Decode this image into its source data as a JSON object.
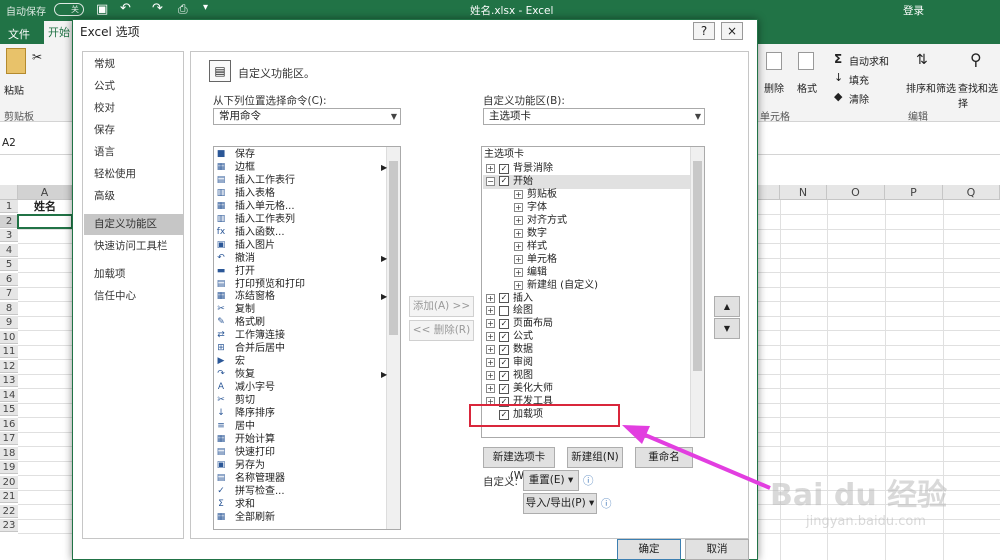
{
  "excel": {
    "autosave": "自动保存",
    "autosave_state": "关",
    "title": "姓名.xlsx  -  Excel",
    "login": "登录",
    "tab_file": "文件",
    "tab_home": "开始",
    "paste": "粘贴",
    "clipboard": "剪贴板",
    "delete": "删除",
    "format": "格式",
    "cells_group": "单元格",
    "autosum": "自动求和",
    "fill": "填充",
    "clear": "清除",
    "sort_filter": "排序和筛选",
    "find_select": "查找和选择",
    "editing_group": "编辑",
    "namebox": "A2",
    "col_a": "A",
    "cols_right": [
      "N",
      "O",
      "P",
      "Q"
    ],
    "a1_value": "姓名",
    "rows": [
      "1",
      "2",
      "3",
      "4",
      "5",
      "6",
      "7",
      "8",
      "9",
      "10",
      "11",
      "12",
      "13",
      "14",
      "15",
      "16",
      "17",
      "18",
      "19",
      "20",
      "21",
      "22",
      "23"
    ]
  },
  "dialog": {
    "title": "Excel 选项",
    "help_btn": "?",
    "close_btn": "×",
    "nav": [
      "常规",
      "公式",
      "校对",
      "保存",
      "语言",
      "轻松使用",
      "高级",
      "自定义功能区",
      "快速访问工具栏",
      "加载项",
      "信任中心"
    ],
    "nav_selected": "自定义功能区",
    "heading": "自定义功能区。",
    "choose_label": "从下列位置选择命令(C):",
    "choose_value": "常用命令",
    "customize_label": "自定义功能区(B):",
    "customize_value": "主选项卡",
    "commands": [
      {
        "icon": "■",
        "text": "保存"
      },
      {
        "icon": "▦",
        "text": "边框",
        "sub": true
      },
      {
        "icon": "▤",
        "text": "插入工作表行"
      },
      {
        "icon": "▥",
        "text": "插入表格"
      },
      {
        "icon": "▦",
        "text": "插入单元格..."
      },
      {
        "icon": "▥",
        "text": "插入工作表列"
      },
      {
        "icon": "fx",
        "text": "插入函数..."
      },
      {
        "icon": "▣",
        "text": "插入图片"
      },
      {
        "icon": "↶",
        "text": "撤消",
        "sub": true
      },
      {
        "icon": "▬",
        "text": "打开"
      },
      {
        "icon": "▤",
        "text": "打印预览和打印"
      },
      {
        "icon": "▦",
        "text": "冻结窗格",
        "sub": true
      },
      {
        "icon": "✂",
        "text": "复制"
      },
      {
        "icon": "✎",
        "text": "格式刷"
      },
      {
        "icon": "⇄",
        "text": "工作簿连接"
      },
      {
        "icon": "⊞",
        "text": "合并后居中"
      },
      {
        "icon": "▶",
        "text": "宏"
      },
      {
        "icon": "↷",
        "text": "恢复",
        "sub": true
      },
      {
        "icon": "A",
        "text": "减小字号"
      },
      {
        "icon": "✂",
        "text": "剪切"
      },
      {
        "icon": "↓",
        "text": "降序排序"
      },
      {
        "icon": "≡",
        "text": "居中"
      },
      {
        "icon": "▦",
        "text": "开始计算"
      },
      {
        "icon": "▤",
        "text": "快速打印"
      },
      {
        "icon": "▣",
        "text": "另存为"
      },
      {
        "icon": "▤",
        "text": "名称管理器"
      },
      {
        "icon": "✓",
        "text": "拼写检查..."
      },
      {
        "icon": "Σ",
        "text": "求和"
      },
      {
        "icon": "▦",
        "text": "全部刷新"
      }
    ],
    "add_btn": "添加(A) >>",
    "remove_btn": "<< 删除(R)",
    "tree_header": "主选项卡",
    "tree": [
      {
        "level": 0,
        "exp": "+",
        "chk": true,
        "text": "背景消除"
      },
      {
        "level": 0,
        "exp": "−",
        "chk": true,
        "text": "开始"
      },
      {
        "level": 1,
        "exp": "+",
        "text": "剪贴板"
      },
      {
        "level": 1,
        "exp": "+",
        "text": "字体"
      },
      {
        "level": 1,
        "exp": "+",
        "text": "对齐方式"
      },
      {
        "level": 1,
        "exp": "+",
        "text": "数字"
      },
      {
        "level": 1,
        "exp": "+",
        "text": "样式"
      },
      {
        "level": 1,
        "exp": "+",
        "text": "单元格"
      },
      {
        "level": 1,
        "exp": "+",
        "text": "编辑"
      },
      {
        "level": 1,
        "exp": "+",
        "text": "新建组 (自定义)"
      },
      {
        "level": 0,
        "exp": "+",
        "chk": true,
        "text": "插入"
      },
      {
        "level": 0,
        "exp": "+",
        "chk": false,
        "text": "绘图"
      },
      {
        "level": 0,
        "exp": "+",
        "chk": true,
        "text": "页面布局"
      },
      {
        "level": 0,
        "exp": "+",
        "chk": true,
        "text": "公式"
      },
      {
        "level": 0,
        "exp": "+",
        "chk": true,
        "text": "数据"
      },
      {
        "level": 0,
        "exp": "+",
        "chk": true,
        "text": "审阅"
      },
      {
        "level": 0,
        "exp": "+",
        "chk": true,
        "text": "视图"
      },
      {
        "level": 0,
        "exp": "+",
        "chk": true,
        "text": "美化大师"
      },
      {
        "level": 0,
        "exp": "+",
        "chk": true,
        "text": "开发工具"
      },
      {
        "level": 0,
        "exp": "",
        "chk": true,
        "text": "加载项"
      }
    ],
    "up_btn": "▲",
    "down_btn": "▼",
    "new_tab_btn": "新建选项卡(W)",
    "new_group_btn": "新建组(N)",
    "rename_btn": "重命名(M)...",
    "customize_lbl": "自定义:",
    "reset_btn": "重置(E) ▾",
    "import_export_btn": "导入/导出(P) ▾",
    "ok_btn": "确定",
    "cancel_btn": "取消"
  },
  "watermark": {
    "brand": "Bai du 经验",
    "url": "jingyan.baidu.com"
  },
  "colors": {
    "excel_green": "#217346",
    "highlight_box": "#d9263b",
    "arrow": "#e23ee0"
  }
}
